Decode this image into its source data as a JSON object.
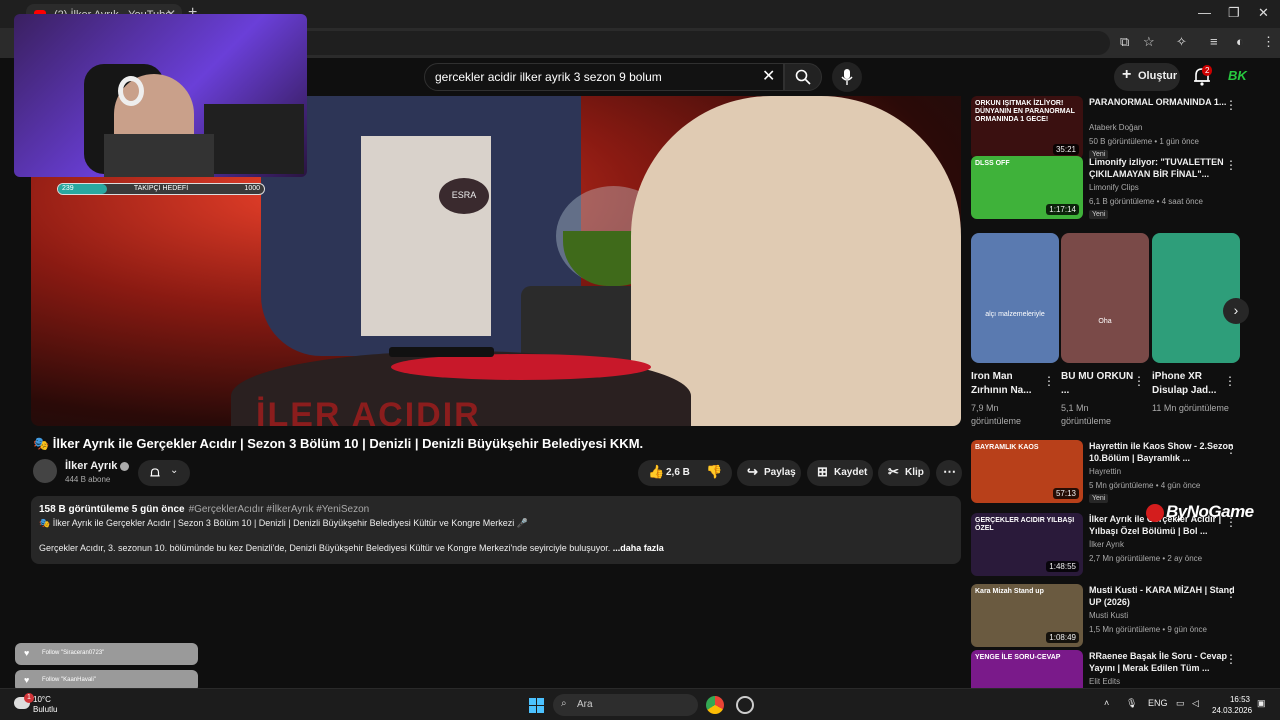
{
  "browser": {
    "tab_title": "(2) İlker Ayrık - YouTube",
    "new_tab": "+",
    "tab_close": "✕"
  },
  "header": {
    "search_query": "gercekler acidir ilker ayrik 3 sezon 9 bolum",
    "create_label": "Oluştur",
    "notifications_count": "2",
    "avatar_text": "BK"
  },
  "stream_overlay": {
    "follow_goal_current": "239",
    "follow_goal_label": "TAKİPÇİ HEDEFİ",
    "follow_goal_max": "1000",
    "follow_goal_fraction": 0.239,
    "toasts": [
      "Follow \"Siraceran0723\"",
      "Follow \"KaanHavali\""
    ],
    "watermark": "ByNoGame"
  },
  "video": {
    "nametag": "ESRA",
    "table_text": "İLER ACIDIR",
    "title": "🎭 İlker Ayrık ile Gerçekler Acıdır | Sezon 3 Bölüm 10 | Denizli | Denizli Büyükşehir Belediyesi KKM.",
    "channel": "İlker Ayrık",
    "subscribers": "444 B abone",
    "like_count": "2,6 B",
    "share_label": "Paylaş",
    "save_label": "Kaydet",
    "clip_label": "Klip",
    "description": {
      "stats": "158 B görüntüleme  5 gün önce",
      "tags": "#GerçeklerAcıdır #İlkerAyrık #YeniSezon",
      "line1": "🎭 İlker Ayrık ile Gerçekler Acıdır | Sezon 3 Bölüm 10 | Denizli | Denizli Büyükşehir Belediyesi Kültür ve Kongre Merkezi 🎤",
      "line2": "Gerçekler Acıdır, 3. sezonun 10. bölümünde bu kez Denizli'de, Denizli Büyükşehir Belediyesi Kültür ve Kongre Merkezi'nde seyirciyle buluşuyor.",
      "more": "...daha fazla"
    }
  },
  "sidebar": {
    "items_top": [
      {
        "title": "PARANORMAL ORMANINDA 1...",
        "channel": "Ataberk Doğan",
        "meta": "50 B görüntüleme • 1 gün önce",
        "duration": "35:21",
        "badge": "Yeni",
        "thumb_color": "#3a1010",
        "thumb_text": "ORKUN IŞITMAK İZLİYOR! DÜNYANIN EN PARANORMAL ORMANINDA 1 GECE!"
      },
      {
        "title": "Limonify izliyor: \"TUVALETTEN ÇIKILAMAYAN BİR FİNAL\"...",
        "channel": "Limonify Clips",
        "meta": "6,1 B görüntüleme • 4 saat önce",
        "duration": "1:17:14",
        "badge": "Yeni",
        "thumb_color": "#3fb23a",
        "thumb_text": "DLSS OFF"
      }
    ],
    "shorts": [
      {
        "title": "Iron Man Zırhının Na...",
        "views": "7,9 Mn görüntüleme",
        "caption": "alçı malzemeleriyle",
        "color": "#5a7ab0"
      },
      {
        "title": "BU MU ORKUN ...",
        "views": "5,1 Mn görüntüleme",
        "caption": "Oha",
        "color": "#7a4a48"
      },
      {
        "title": "iPhone XR Disulap Jad...",
        "views": "11 Mn görüntüleme",
        "caption": "",
        "color": "#2e9e7a"
      }
    ],
    "items_bottom": [
      {
        "title": "Hayrettin ile Kaos Show - 2.Sezon 10.Bölüm | Bayramlık ...",
        "channel": "Hayrettin",
        "meta": "5 Mn görüntüleme • 4 gün önce",
        "duration": "57:13",
        "badge": "Yeni",
        "thumb_color": "#b8401a",
        "thumb_text": "BAYRAMLIK KAOS"
      },
      {
        "title": "İlker Ayrık ile Gerçekler Acıdır | Yılbaşı Özel Bölümü | Bol ...",
        "channel": "İlker Ayrık",
        "meta": "2,7 Mn görüntüleme • 2 ay önce",
        "duration": "1:48:55",
        "badge": "",
        "thumb_color": "#2a1a3a",
        "thumb_text": "GERÇEKLER ACIDIR YILBAŞI ÖZEL"
      },
      {
        "title": "Musti Kusti - KARA MİZAH | Stand UP (2026)",
        "channel": "Musti Kusti",
        "meta": "1,5 Mn görüntüleme • 9 gün önce",
        "duration": "1:08:49",
        "badge": "",
        "thumb_color": "#6a5a40",
        "thumb_text": "Kara Mizah Stand up"
      },
      {
        "title": "RRaenee Başak İle Soru - Cevap Yayını | Merak Edilen Tüm ...",
        "channel": "Elit Edits",
        "meta": "",
        "duration": "",
        "badge": "",
        "thumb_color": "#7a1a8a",
        "thumb_text": "YENGE İLE SORU-CEVAP"
      }
    ]
  },
  "taskbar": {
    "temperature": "10°C",
    "weather": "Bulutlu",
    "weather_badge": "1",
    "search_placeholder": "Ara",
    "language": "ENG",
    "time": "16:53",
    "date": "24.03.2026"
  }
}
